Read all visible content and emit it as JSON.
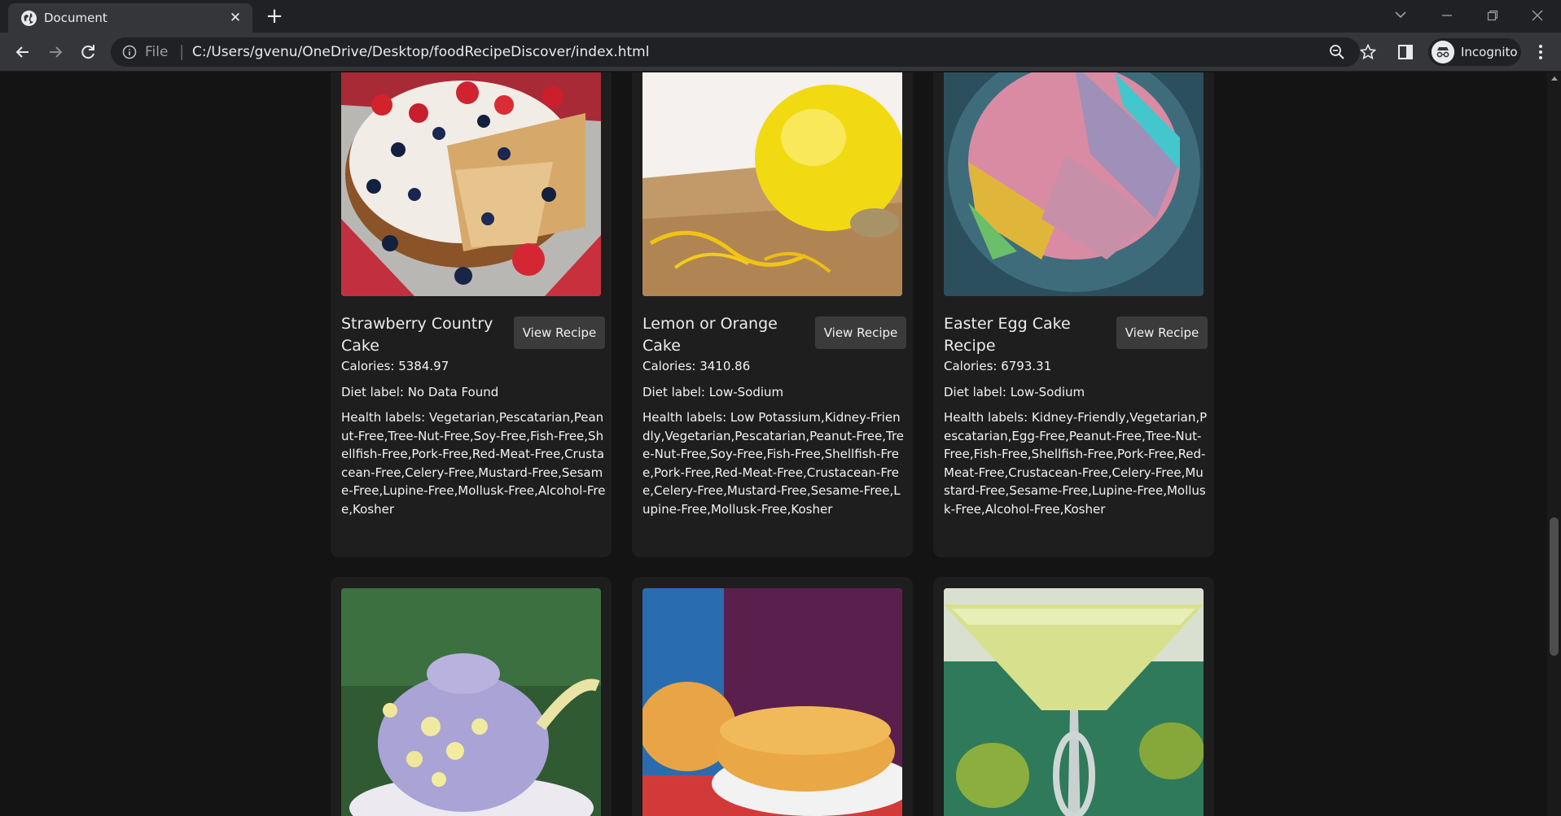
{
  "browser": {
    "tab_title": "Document",
    "url_scheme": "File",
    "url": "C:/Users/gvenu/OneDrive/Desktop/foodRecipeDiscover/index.html",
    "profile_label": "Incognito"
  },
  "recipes": [
    {
      "title": "Strawberry Country Cake",
      "button": "View Recipe",
      "calories": "Calories: 5384.97",
      "diet": "Diet label: No Data Found",
      "health": "Health labels: Vegetarian,Pescatarian,Peanut-Free,Tree-Nut-Free,Soy-Free,Fish-Free,Shellfish-Free,Pork-Free,Red-Meat-Free,Crustacean-Free,Celery-Free,Mustard-Free,Sesame-Free,Lupine-Free,Mollusk-Free,Alcohol-Free,Kosher",
      "image": "strawberry-cake-photo"
    },
    {
      "title": "Lemon or Orange Cake",
      "button": "View Recipe",
      "calories": "Calories: 3410.86",
      "diet": "Diet label: Low-Sodium",
      "health": "Health labels: Low Potassium,Kidney-Friendly,Vegetarian,Pescatarian,Peanut-Free,Tree-Nut-Free,Soy-Free,Fish-Free,Shellfish-Free,Pork-Free,Red-Meat-Free,Crustacean-Free,Celery-Free,Mustard-Free,Sesame-Free,Lupine-Free,Mollusk-Free,Kosher",
      "image": "lemon-photo"
    },
    {
      "title": "Easter Egg Cake Recipe",
      "button": "View Recipe",
      "calories": "Calories: 6793.31",
      "diet": "Diet label: Low-Sodium",
      "health": "Health labels: Kidney-Friendly,Vegetarian,Pescatarian,Egg-Free,Peanut-Free,Tree-Nut-Free,Fish-Free,Shellfish-Free,Pork-Free,Red-Meat-Free,Crustacean-Free,Celery-Free,Mustard-Free,Sesame-Free,Lupine-Free,Mollusk-Free,Alcohol-Free,Kosher",
      "image": "easter-egg-cake-photo"
    },
    {
      "image": "teapot-cake-photo"
    },
    {
      "image": "sponge-cake-photo"
    },
    {
      "image": "cocktail-photo"
    }
  ]
}
